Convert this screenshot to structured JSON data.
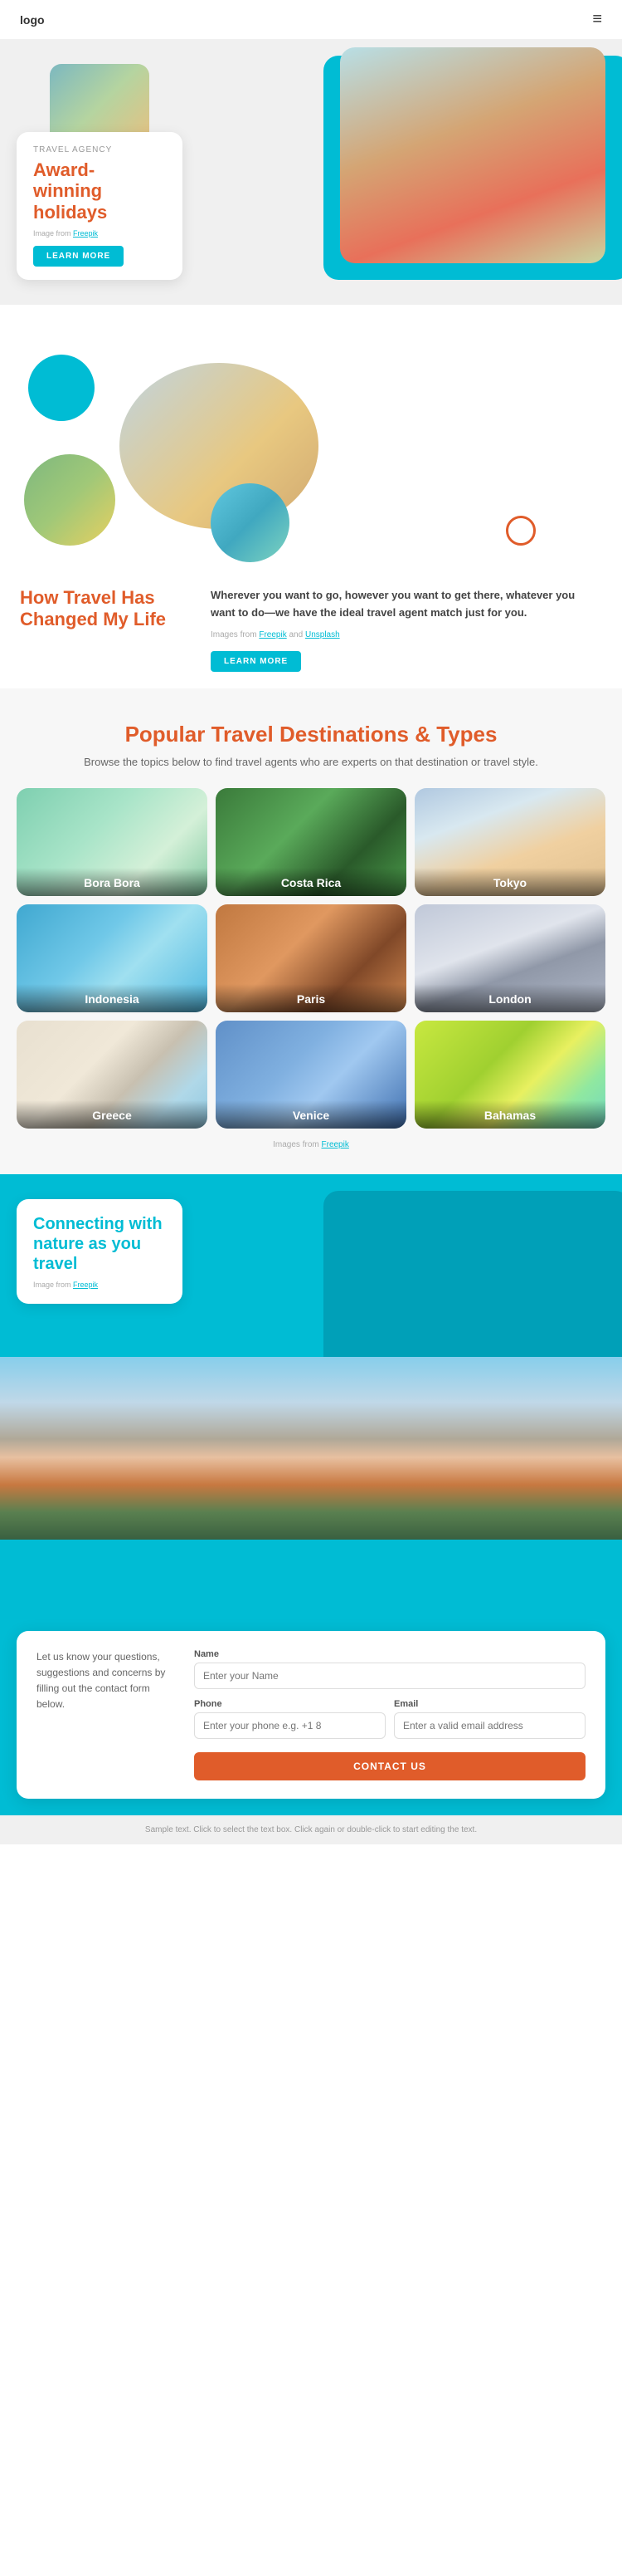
{
  "header": {
    "logo": "logo",
    "menu_icon": "≡"
  },
  "hero": {
    "agency_label": "TRAVEL AGENCY",
    "title_line1": "Award-",
    "title_line2": "winning",
    "title_line3": "holidays",
    "img_credit_text": "Image from ",
    "img_credit_link": "Freepik",
    "learn_more": "LEARN MORE"
  },
  "how_travel": {
    "heading_line1": "How Travel Has",
    "heading_line2": "Changed My Life",
    "body": "Wherever you want to go, however you want to get there, whatever you want to do—we have the ideal travel agent match just for you.",
    "img_credits_prefix": "Images from ",
    "img_credit_freepik": "Freepik",
    "img_credits_and": " and ",
    "img_credit_unsplash": "Unsplash",
    "learn_more": "LEARN MORE"
  },
  "destinations": {
    "heading": "Popular Travel Destinations & Types",
    "subheading": "Browse the topics below to find travel agents who are experts on that destination or travel style.",
    "grid": [
      {
        "name": "Bora Bora",
        "class": "dest-bora-bora"
      },
      {
        "name": "Costa Rica",
        "class": "dest-costa-rica"
      },
      {
        "name": "Tokyo",
        "class": "dest-tokyo"
      },
      {
        "name": "Indonesia",
        "class": "dest-indonesia"
      },
      {
        "name": "Paris",
        "class": "dest-paris"
      },
      {
        "name": "London",
        "class": "dest-london"
      },
      {
        "name": "Greece",
        "class": "dest-greece"
      },
      {
        "name": "Venice",
        "class": "dest-venice"
      },
      {
        "name": "Bahamas",
        "class": "dest-bahamas"
      }
    ],
    "credits_text": "Images from ",
    "credits_link": "Freepik"
  },
  "nature": {
    "heading_line1": "Connecting with",
    "heading_line2": "nature as you travel",
    "img_credit_text": "Image from ",
    "img_credit_link": "Freepik"
  },
  "contact": {
    "intro": "Let us know your questions, suggestions and concerns by filling out the contact form below.",
    "name_label": "Name",
    "name_placeholder": "Enter your Name",
    "phone_label": "Phone",
    "phone_placeholder": "Enter your phone e.g. +1 8",
    "email_label": "Email",
    "email_placeholder": "Enter a valid email address",
    "button": "CONTACT US"
  },
  "footer": {
    "note": "Sample text. Click to select the text box. Click again or double-click to start editing the text."
  }
}
